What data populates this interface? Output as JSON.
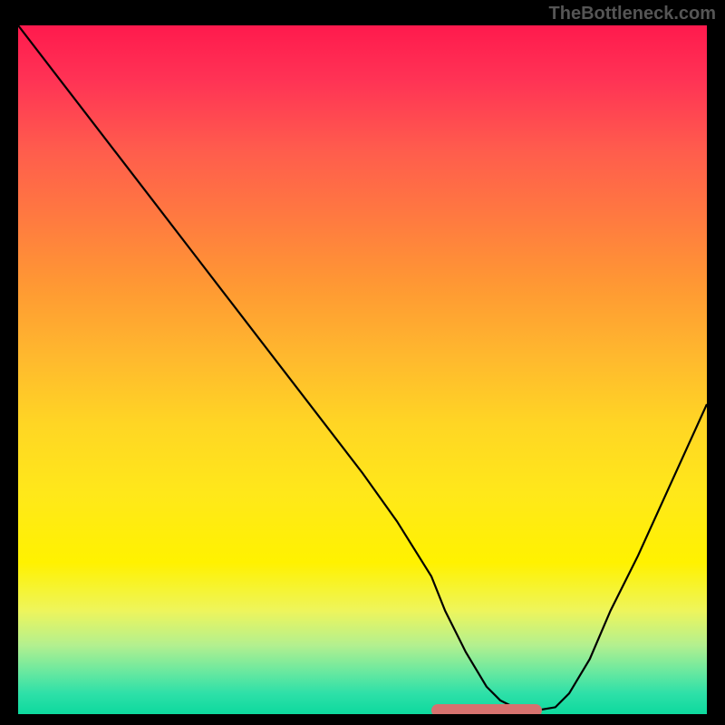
{
  "watermark": "TheBottleneck.com",
  "chart_data": {
    "type": "line",
    "title": "",
    "xlabel": "",
    "ylabel": "",
    "xlim": [
      0,
      100
    ],
    "ylim": [
      0,
      100
    ],
    "series": [
      {
        "name": "curve",
        "x": [
          0,
          5,
          10,
          15,
          20,
          25,
          30,
          35,
          40,
          45,
          50,
          55,
          60,
          62,
          65,
          68,
          70,
          72,
          75,
          78,
          80,
          83,
          86,
          90,
          95,
          100
        ],
        "y": [
          100,
          93.5,
          87,
          80.5,
          74,
          67.5,
          61,
          54.5,
          48,
          41.5,
          35,
          28,
          20,
          15,
          9,
          4,
          2,
          1,
          0.5,
          1,
          3,
          8,
          15,
          23,
          34,
          45
        ]
      }
    ],
    "markers": [
      {
        "x_start": 60,
        "x_end": 76,
        "y": 0.5,
        "color": "#d6726f"
      }
    ],
    "background_gradient": {
      "stops": [
        {
          "pos": 0,
          "color": "#ff1a4d"
        },
        {
          "pos": 0.5,
          "color": "#ffd624"
        },
        {
          "pos": 0.85,
          "color": "#eef55c"
        },
        {
          "pos": 1.0,
          "color": "#0dd99e"
        }
      ]
    }
  }
}
